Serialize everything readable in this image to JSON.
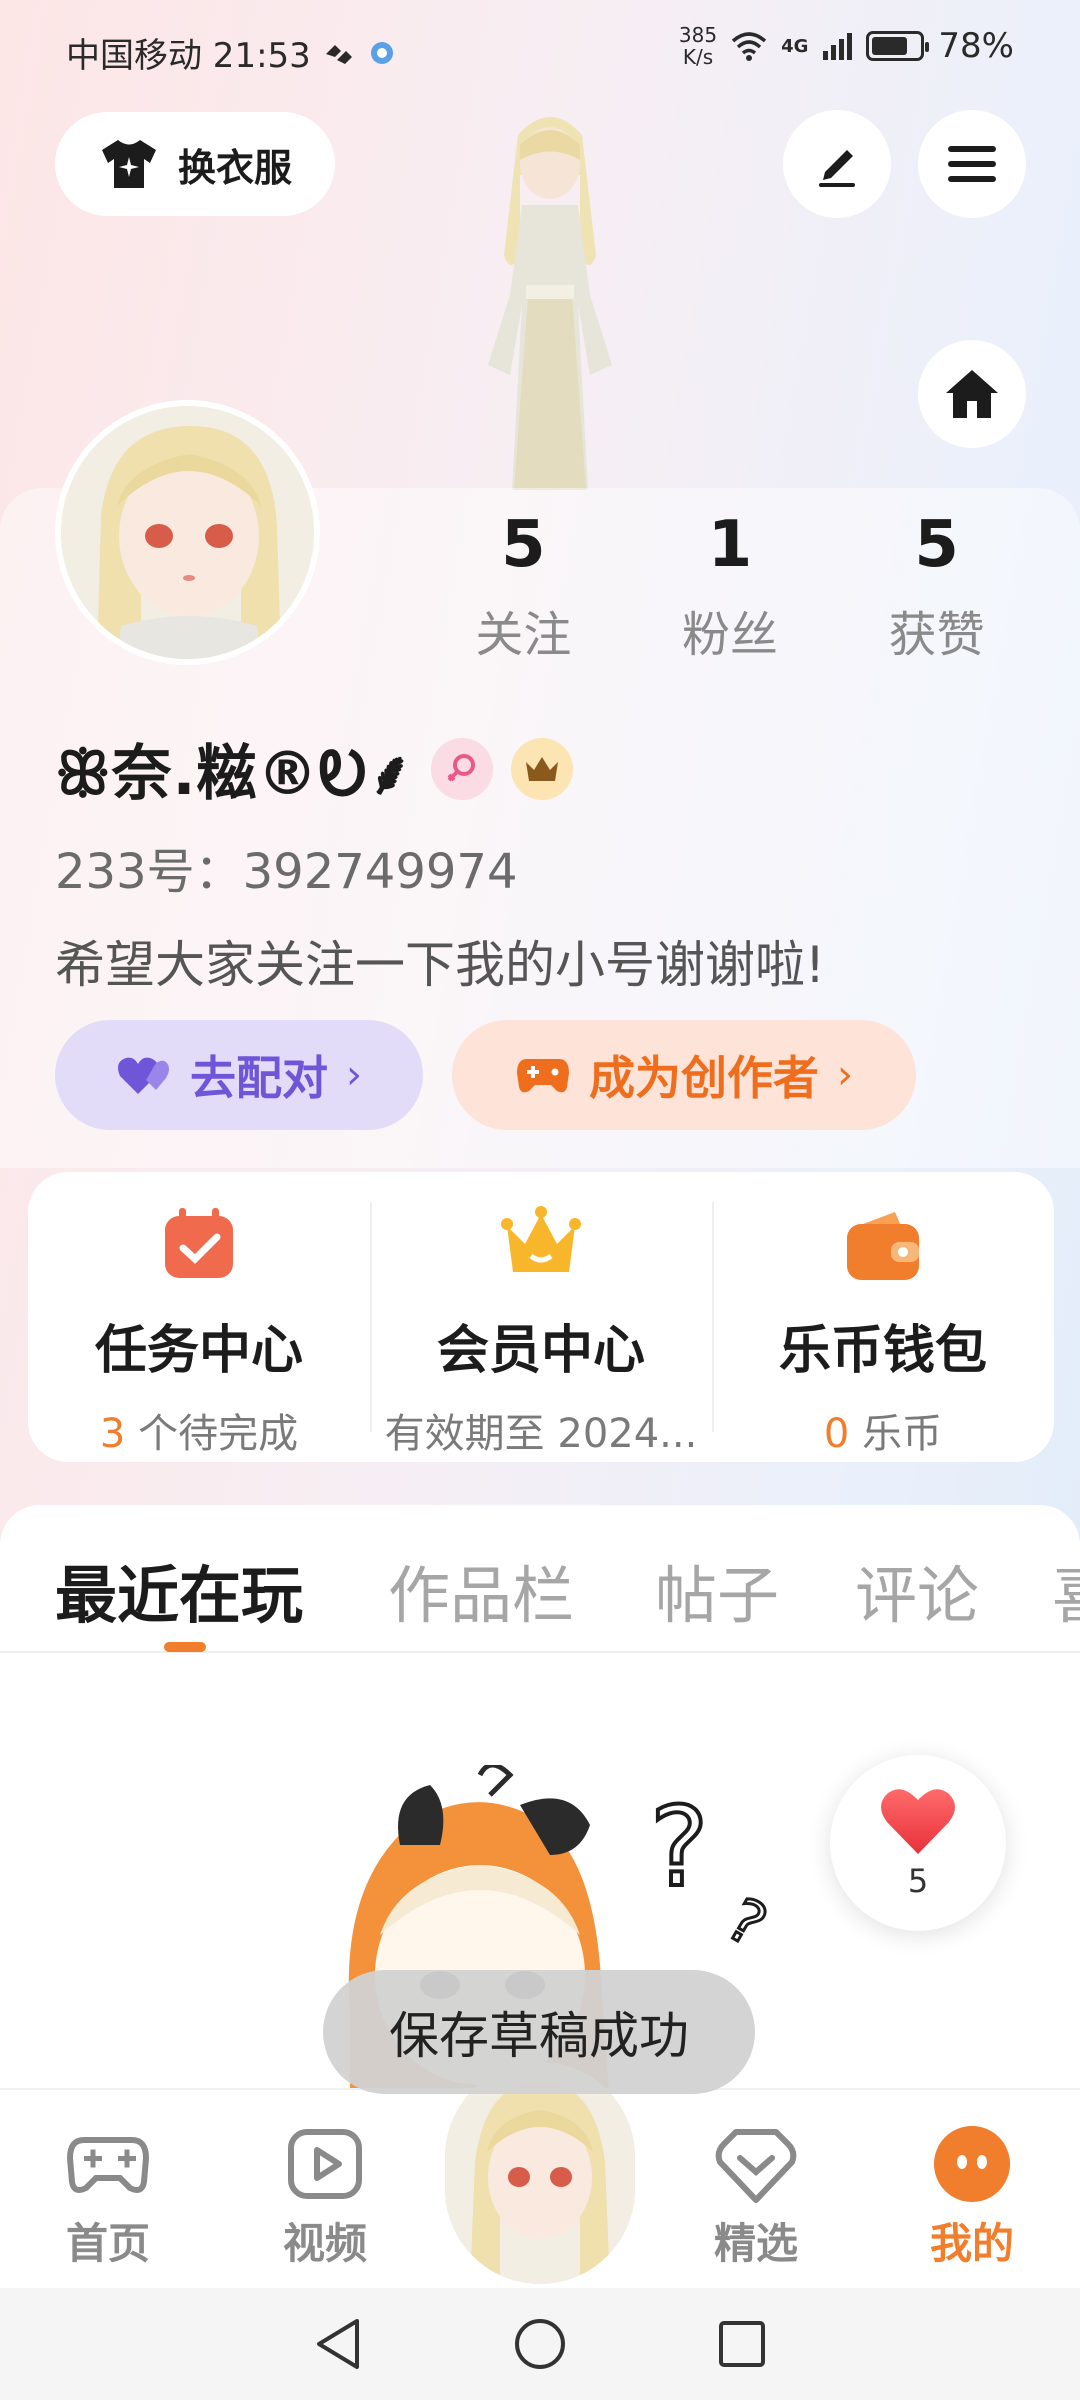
{
  "status_bar": {
    "carrier_time": "中国移动 21:53",
    "net_speed_value": "385",
    "net_speed_unit": "K/s",
    "network": "4G",
    "battery": "78%",
    "battery_level": 0.78
  },
  "top": {
    "dress_label": "换衣服"
  },
  "profile": {
    "username": "ꕥ奈.糍®Ꭷ⸙",
    "uid_label": "233号：",
    "uid": "392749974",
    "bio": "希望大家关注一下我的小号谢谢啦!",
    "stats": [
      {
        "value": "5",
        "label": "关注"
      },
      {
        "value": "1",
        "label": "粉丝"
      },
      {
        "value": "5",
        "label": "获赞"
      }
    ]
  },
  "actions": {
    "match_label": "去配对",
    "creator_label": "成为创作者"
  },
  "services": [
    {
      "title": "任务中心",
      "num": "3",
      "sub": " 个待完成"
    },
    {
      "title": "会员中心",
      "num": "",
      "sub": "有效期至 2024..."
    },
    {
      "title": "乐币钱包",
      "num": "0",
      "sub": " 乐币"
    }
  ],
  "tabs": [
    "最近在玩",
    "作品栏",
    "帖子",
    "评论",
    "喜"
  ],
  "like_count": "5",
  "toast": "保存草稿成功",
  "nav": [
    {
      "label": "首页"
    },
    {
      "label": "视频"
    },
    {
      "label": "精选"
    },
    {
      "label": "我的"
    }
  ],
  "colors": {
    "accent": "#f07e2c",
    "purple": "#6f55d8"
  }
}
